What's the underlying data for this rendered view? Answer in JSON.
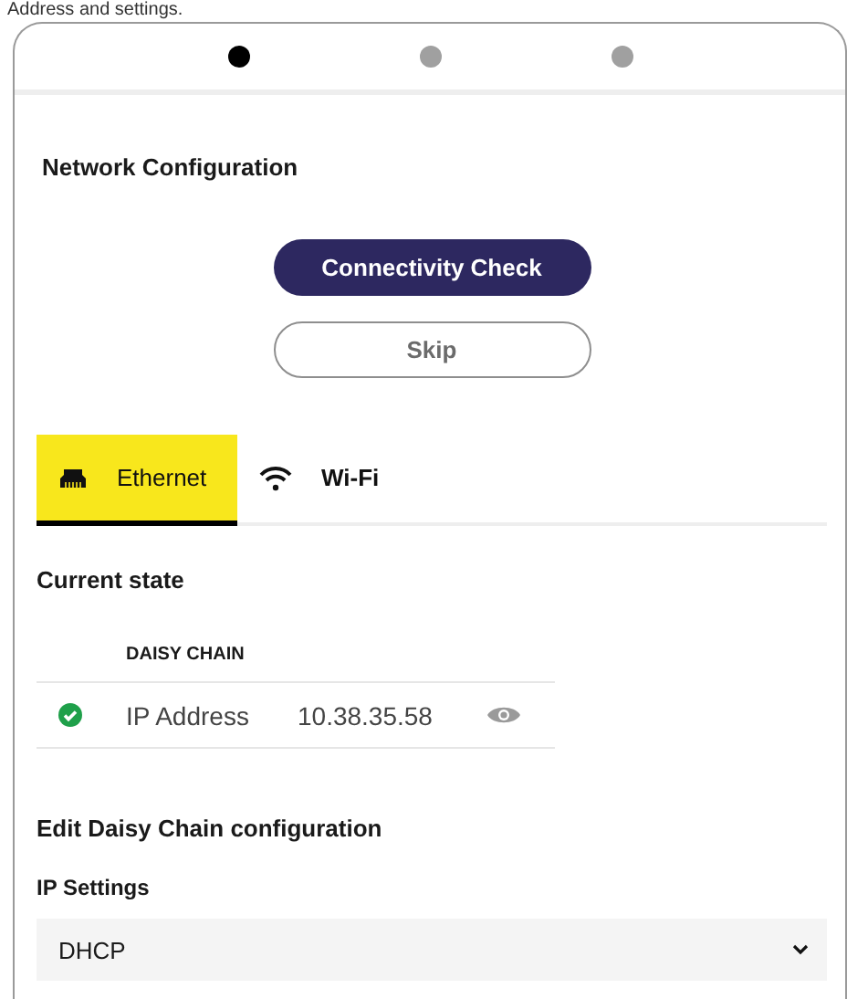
{
  "caption": "Address and settings.",
  "steps": [
    {
      "selected": true
    },
    {
      "selected": false
    },
    {
      "selected": false
    }
  ],
  "title": "Network Configuration",
  "buttons": [
    {
      "label": "Connectivity Check",
      "kind": "primary"
    },
    {
      "label": "Skip",
      "kind": "secondary"
    }
  ],
  "tabs": [
    {
      "label": "Ethernet",
      "kind": "ethernet",
      "selected": true
    },
    {
      "label": "Wi-Fi",
      "kind": "wifi",
      "selected": false
    }
  ],
  "current_state": {
    "title": "Current state",
    "table_heading": "DAISY CHAIN",
    "rows": [
      {
        "ok": true,
        "label": "IP Address",
        "value": "10.38.35.58"
      }
    ]
  },
  "edit": {
    "title": "Edit Daisy Chain configuration",
    "field_label": "IP Settings",
    "value": "DHCP"
  }
}
